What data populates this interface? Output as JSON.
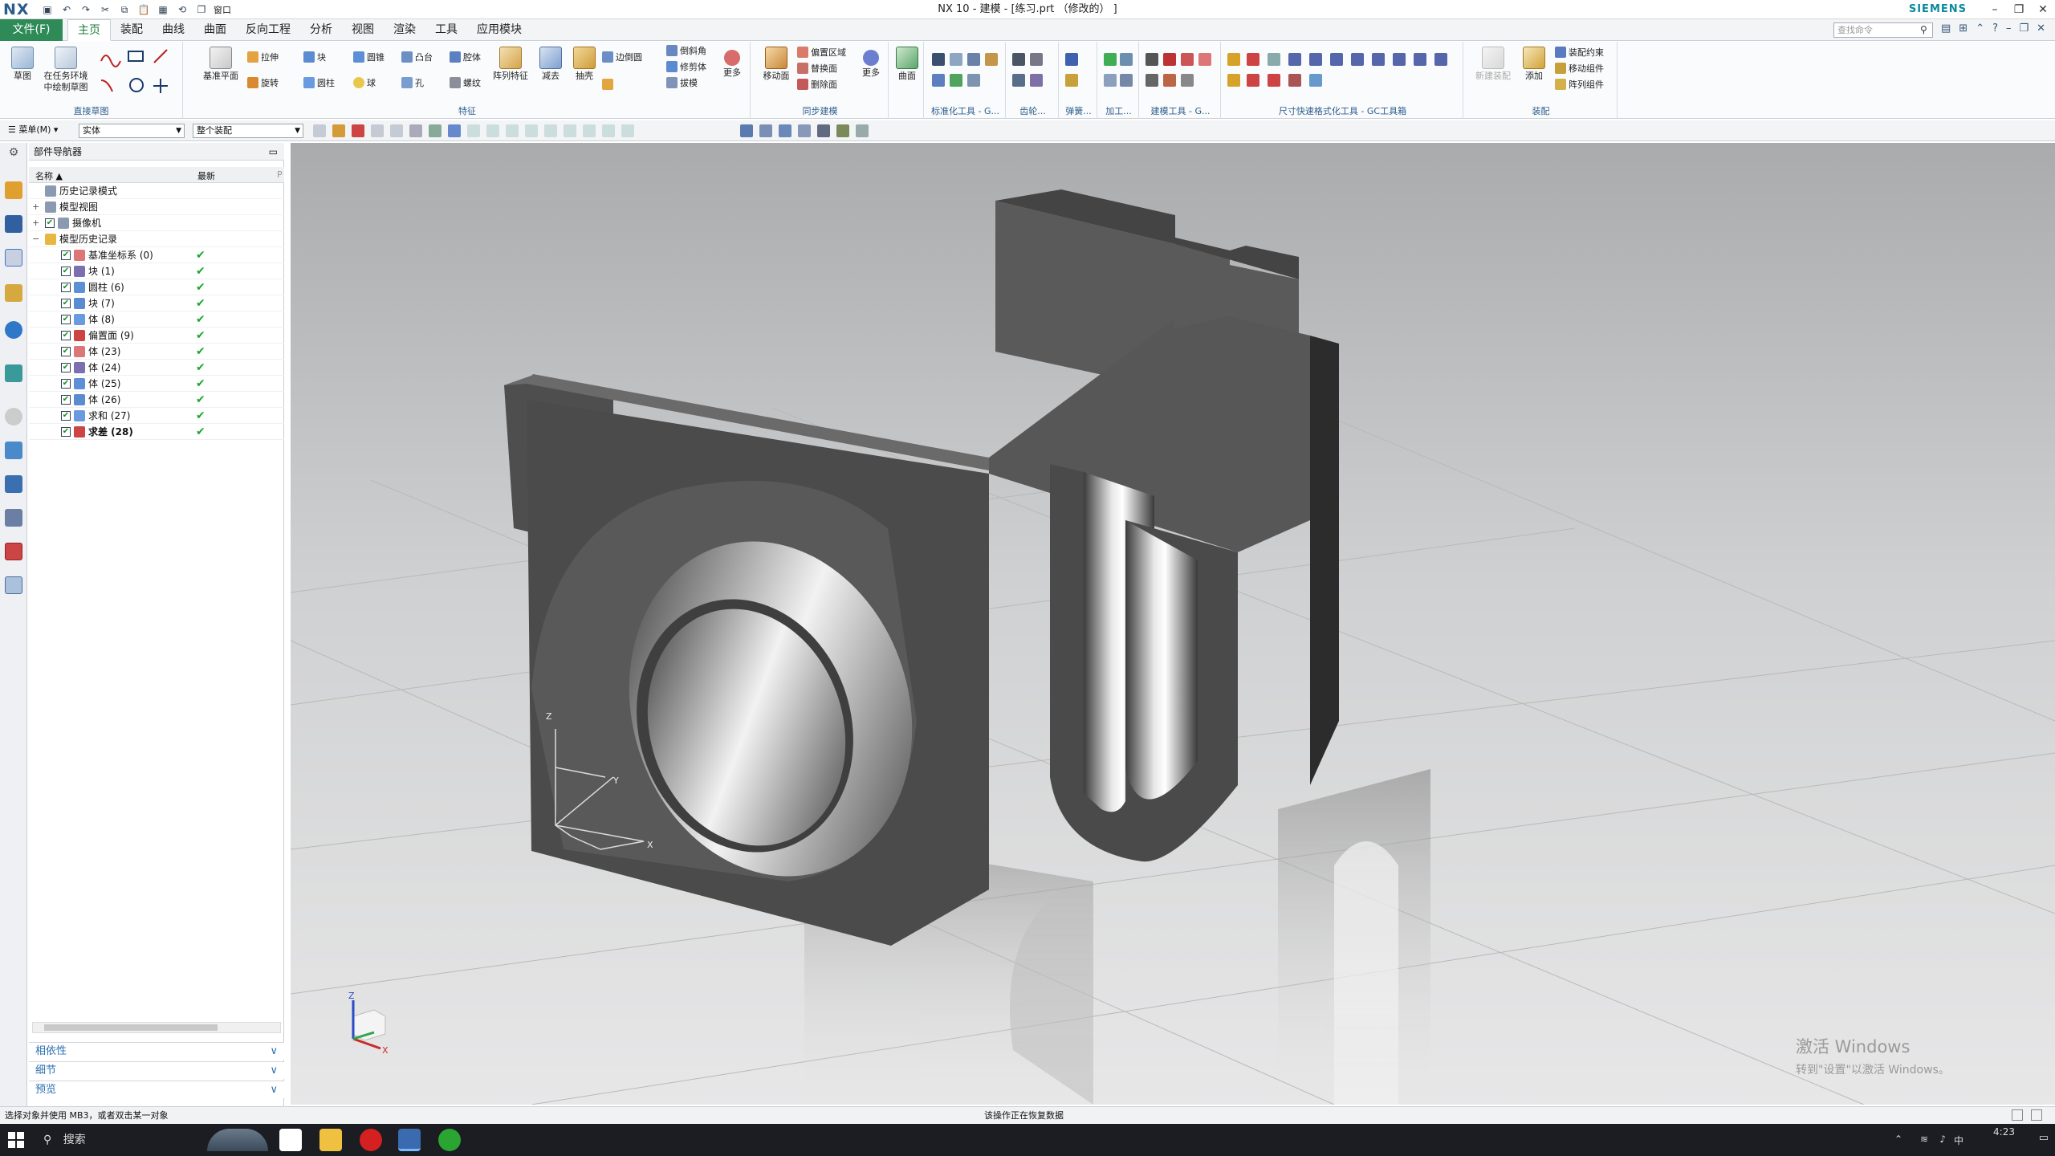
{
  "app": {
    "logo": "NX",
    "title": "NX 10 - 建模 - [练习.prt （修改的） ]",
    "brand": "SIEMENS",
    "window_menu": "窗口",
    "search_placeholder": "查找命令"
  },
  "tabs": {
    "file": "文件(F)",
    "items": [
      "主页",
      "装配",
      "曲线",
      "曲面",
      "反向工程",
      "分析",
      "视图",
      "渲染",
      "工具",
      "应用模块"
    ],
    "active": "主页"
  },
  "ribbon": {
    "sketch_group": {
      "label": "直接草图",
      "btn_sketch": "草图",
      "btn_task_env": "在任务环境中绘制草图"
    },
    "feature_group": {
      "label": "特征",
      "datum_plane": "基准平面",
      "extrude": "拉伸",
      "block": "块",
      "cone": "圆锥",
      "boss": "凸台",
      "cavity": "腔体",
      "pattern": "阵列特征",
      "subtract": "减去",
      "shell": "抽壳",
      "edge_blend": "边倒圆",
      "chamfer": "倒斜角",
      "trim_body": "修剪体",
      "draft": "拔模",
      "revolve": "旋转",
      "cylinder": "圆柱",
      "sphere": "球",
      "hole": "孔",
      "thread": "螺纹",
      "more": "更多"
    },
    "sync_group": {
      "label": "同步建模",
      "move_face": "移动面",
      "offset_region": "偏置区域",
      "replace_face": "替换面",
      "delete_face": "删除面",
      "more": "更多"
    },
    "surface_group": {
      "label": "",
      "surface": "曲面"
    },
    "std_tools": "标准化工具 - G...",
    "gear": "齿轮...",
    "spring": "弹簧...",
    "machining": "加工...",
    "modeling_tools": "建模工具 - G...",
    "dim_tools": "尺寸快速格式化工具 - GC工具箱",
    "assembly_group": {
      "label": "装配",
      "add": "添加",
      "assy_constraint": "装配约束",
      "move_component": "移动组件",
      "array_component": "阵列组件",
      "inactive_btn": "新建装配"
    }
  },
  "selection": {
    "menu": "菜单(M)",
    "filter": "实体",
    "scope": "整个装配"
  },
  "navigator": {
    "title": "部件导航器",
    "col_name": "名称",
    "col_latest": "最新",
    "items": [
      {
        "label": "历史记录模式",
        "level": 0,
        "check": false,
        "ok": false
      },
      {
        "label": "模型视图",
        "level": 0,
        "check": false,
        "ok": false
      },
      {
        "label": "摄像机",
        "level": 0,
        "check": true,
        "ok": false
      },
      {
        "label": "模型历史记录",
        "level": 0,
        "check": false,
        "ok": false
      },
      {
        "label": "基准坐标系 (0)",
        "level": 1,
        "check": true,
        "ok": true
      },
      {
        "label": "块 (1)",
        "level": 1,
        "check": true,
        "ok": true
      },
      {
        "label": "圆柱 (6)",
        "level": 1,
        "check": true,
        "ok": true
      },
      {
        "label": "块 (7)",
        "level": 1,
        "check": true,
        "ok": true
      },
      {
        "label": "体 (8)",
        "level": 1,
        "check": true,
        "ok": true
      },
      {
        "label": "偏置面 (9)",
        "level": 1,
        "check": true,
        "ok": true
      },
      {
        "label": "体 (23)",
        "level": 1,
        "check": true,
        "ok": true
      },
      {
        "label": "体 (24)",
        "level": 1,
        "check": true,
        "ok": true
      },
      {
        "label": "体 (25)",
        "level": 1,
        "check": true,
        "ok": true
      },
      {
        "label": "体 (26)",
        "level": 1,
        "check": true,
        "ok": true
      },
      {
        "label": "求和 (27)",
        "level": 1,
        "check": true,
        "ok": true
      },
      {
        "label": "求差 (28)",
        "level": 1,
        "check": true,
        "ok": true,
        "bold": true
      }
    ],
    "panels": [
      "相依性",
      "细节",
      "预览"
    ]
  },
  "viewport": {
    "axis_labels": {
      "x": "X",
      "y": "Y",
      "z": "Z"
    },
    "watermark_line1": "激活 Windows",
    "watermark_line2": "转到\"设置\"以激活 Windows。"
  },
  "status": {
    "left": "选择对象并使用 MB3，或者双击某一对象",
    "center": "该操作正在恢复数据"
  },
  "taskbar": {
    "search": "搜索",
    "time": "4:23",
    "ime": "中"
  },
  "colors": {
    "accent": "#2e8b57",
    "link": "#2a6fb0",
    "check": "#1aa531"
  }
}
